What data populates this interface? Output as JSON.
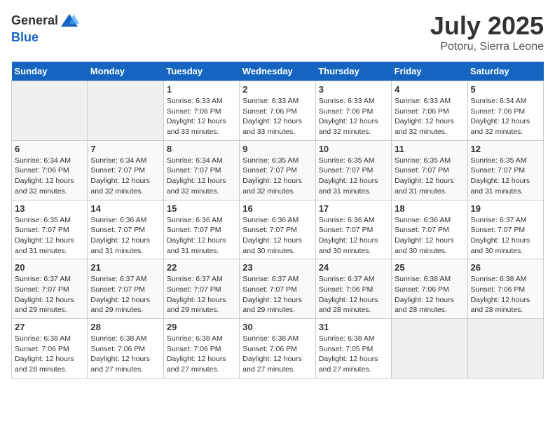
{
  "header": {
    "logo_general": "General",
    "logo_blue": "Blue",
    "month": "July 2025",
    "location": "Potoru, Sierra Leone"
  },
  "days_of_week": [
    "Sunday",
    "Monday",
    "Tuesday",
    "Wednesday",
    "Thursday",
    "Friday",
    "Saturday"
  ],
  "weeks": [
    [
      {
        "day": "",
        "info": ""
      },
      {
        "day": "",
        "info": ""
      },
      {
        "day": "1",
        "info": "Sunrise: 6:33 AM\nSunset: 7:06 PM\nDaylight: 12 hours and 33 minutes."
      },
      {
        "day": "2",
        "info": "Sunrise: 6:33 AM\nSunset: 7:06 PM\nDaylight: 12 hours and 33 minutes."
      },
      {
        "day": "3",
        "info": "Sunrise: 6:33 AM\nSunset: 7:06 PM\nDaylight: 12 hours and 32 minutes."
      },
      {
        "day": "4",
        "info": "Sunrise: 6:33 AM\nSunset: 7:06 PM\nDaylight: 12 hours and 32 minutes."
      },
      {
        "day": "5",
        "info": "Sunrise: 6:34 AM\nSunset: 7:06 PM\nDaylight: 12 hours and 32 minutes."
      }
    ],
    [
      {
        "day": "6",
        "info": "Sunrise: 6:34 AM\nSunset: 7:06 PM\nDaylight: 12 hours and 32 minutes."
      },
      {
        "day": "7",
        "info": "Sunrise: 6:34 AM\nSunset: 7:07 PM\nDaylight: 12 hours and 32 minutes."
      },
      {
        "day": "8",
        "info": "Sunrise: 6:34 AM\nSunset: 7:07 PM\nDaylight: 12 hours and 32 minutes."
      },
      {
        "day": "9",
        "info": "Sunrise: 6:35 AM\nSunset: 7:07 PM\nDaylight: 12 hours and 32 minutes."
      },
      {
        "day": "10",
        "info": "Sunrise: 6:35 AM\nSunset: 7:07 PM\nDaylight: 12 hours and 31 minutes."
      },
      {
        "day": "11",
        "info": "Sunrise: 6:35 AM\nSunset: 7:07 PM\nDaylight: 12 hours and 31 minutes."
      },
      {
        "day": "12",
        "info": "Sunrise: 6:35 AM\nSunset: 7:07 PM\nDaylight: 12 hours and 31 minutes."
      }
    ],
    [
      {
        "day": "13",
        "info": "Sunrise: 6:35 AM\nSunset: 7:07 PM\nDaylight: 12 hours and 31 minutes."
      },
      {
        "day": "14",
        "info": "Sunrise: 6:36 AM\nSunset: 7:07 PM\nDaylight: 12 hours and 31 minutes."
      },
      {
        "day": "15",
        "info": "Sunrise: 6:36 AM\nSunset: 7:07 PM\nDaylight: 12 hours and 31 minutes."
      },
      {
        "day": "16",
        "info": "Sunrise: 6:36 AM\nSunset: 7:07 PM\nDaylight: 12 hours and 30 minutes."
      },
      {
        "day": "17",
        "info": "Sunrise: 6:36 AM\nSunset: 7:07 PM\nDaylight: 12 hours and 30 minutes."
      },
      {
        "day": "18",
        "info": "Sunrise: 6:36 AM\nSunset: 7:07 PM\nDaylight: 12 hours and 30 minutes."
      },
      {
        "day": "19",
        "info": "Sunrise: 6:37 AM\nSunset: 7:07 PM\nDaylight: 12 hours and 30 minutes."
      }
    ],
    [
      {
        "day": "20",
        "info": "Sunrise: 6:37 AM\nSunset: 7:07 PM\nDaylight: 12 hours and 29 minutes."
      },
      {
        "day": "21",
        "info": "Sunrise: 6:37 AM\nSunset: 7:07 PM\nDaylight: 12 hours and 29 minutes."
      },
      {
        "day": "22",
        "info": "Sunrise: 6:37 AM\nSunset: 7:07 PM\nDaylight: 12 hours and 29 minutes."
      },
      {
        "day": "23",
        "info": "Sunrise: 6:37 AM\nSunset: 7:07 PM\nDaylight: 12 hours and 29 minutes."
      },
      {
        "day": "24",
        "info": "Sunrise: 6:37 AM\nSunset: 7:06 PM\nDaylight: 12 hours and 28 minutes."
      },
      {
        "day": "25",
        "info": "Sunrise: 6:38 AM\nSunset: 7:06 PM\nDaylight: 12 hours and 28 minutes."
      },
      {
        "day": "26",
        "info": "Sunrise: 6:38 AM\nSunset: 7:06 PM\nDaylight: 12 hours and 28 minutes."
      }
    ],
    [
      {
        "day": "27",
        "info": "Sunrise: 6:38 AM\nSunset: 7:06 PM\nDaylight: 12 hours and 28 minutes."
      },
      {
        "day": "28",
        "info": "Sunrise: 6:38 AM\nSunset: 7:06 PM\nDaylight: 12 hours and 27 minutes."
      },
      {
        "day": "29",
        "info": "Sunrise: 6:38 AM\nSunset: 7:06 PM\nDaylight: 12 hours and 27 minutes."
      },
      {
        "day": "30",
        "info": "Sunrise: 6:38 AM\nSunset: 7:06 PM\nDaylight: 12 hours and 27 minutes."
      },
      {
        "day": "31",
        "info": "Sunrise: 6:38 AM\nSunset: 7:05 PM\nDaylight: 12 hours and 27 minutes."
      },
      {
        "day": "",
        "info": ""
      },
      {
        "day": "",
        "info": ""
      }
    ]
  ]
}
